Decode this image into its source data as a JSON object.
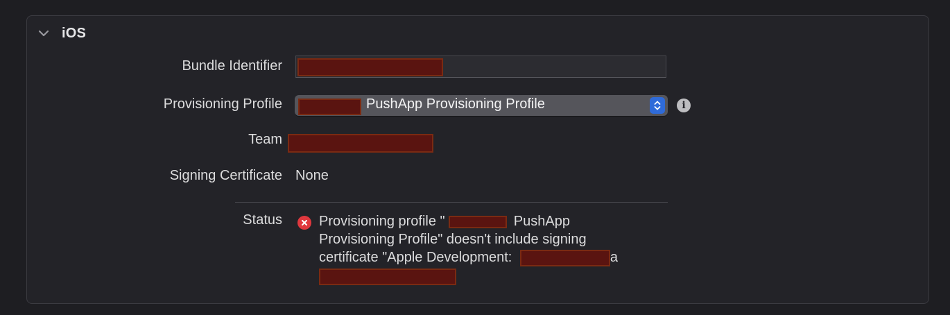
{
  "section": {
    "title": "iOS",
    "chevron_icon": "chevron-down-icon"
  },
  "fields": {
    "bundle_identifier": {
      "label": "Bundle Identifier",
      "value": ""
    },
    "provisioning_profile": {
      "label": "Provisioning Profile",
      "selected": "PushApp Provisioning Profile",
      "stepper_icon": "up-down-chevron-icon",
      "info_icon": "info-icon"
    },
    "team": {
      "label": "Team",
      "value": ""
    },
    "signing_certificate": {
      "label": "Signing Certificate",
      "value": "None"
    },
    "status": {
      "label": "Status",
      "icon": "error-icon",
      "line1_prefix": "Provisioning profile \"",
      "line1_suffix": "PushApp",
      "line2": "Provisioning Profile\" doesn't include signing",
      "line3_prefix": "certificate \"Apple Development:",
      "line3_suffix": "a"
    }
  },
  "colors": {
    "background": "#1e1e22",
    "panel": "#232328",
    "accent": "#2f6bd9",
    "error": "#e0383e",
    "redaction": "#5a1410"
  }
}
